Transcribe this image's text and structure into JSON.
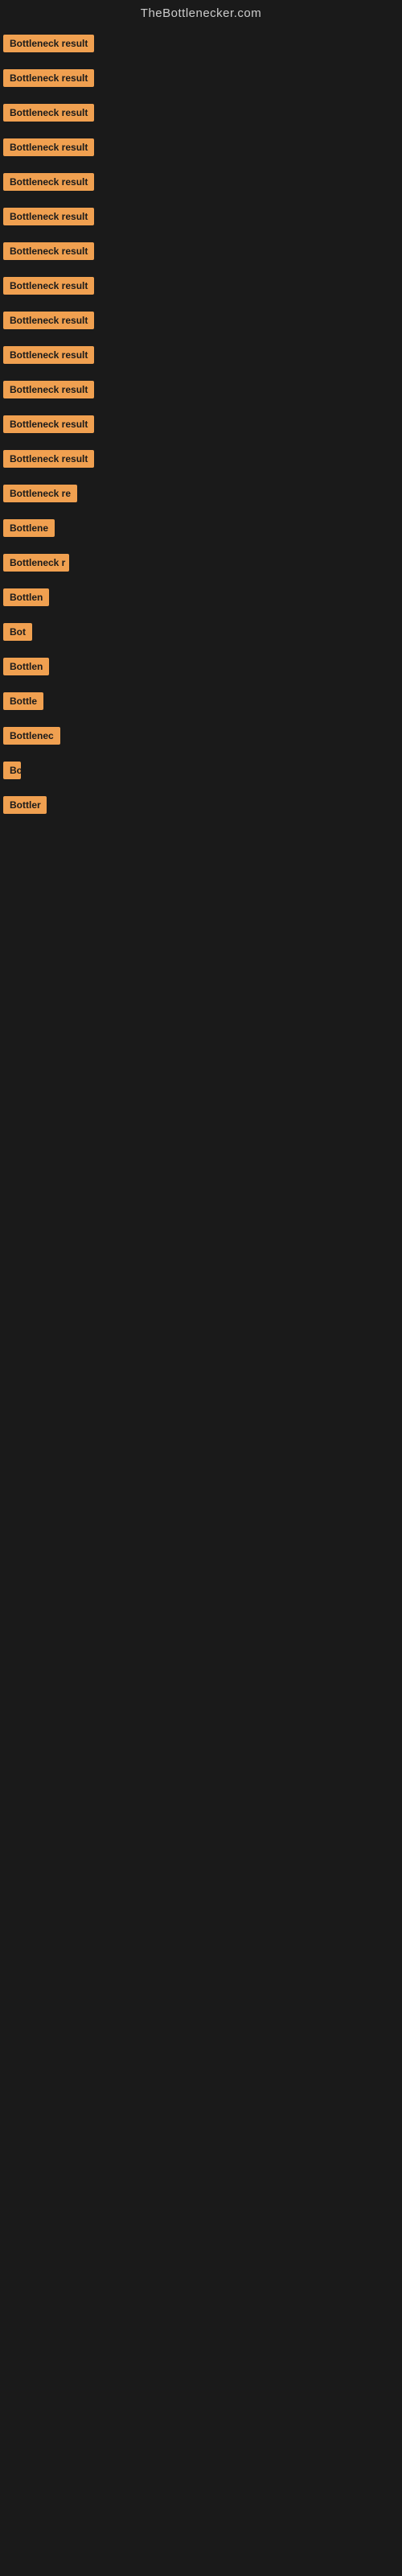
{
  "site": {
    "title": "TheBottlenecker.com"
  },
  "items": [
    {
      "id": 1,
      "label": "Bottleneck result",
      "width": 120
    },
    {
      "id": 2,
      "label": "Bottleneck result",
      "width": 120
    },
    {
      "id": 3,
      "label": "Bottleneck result",
      "width": 120
    },
    {
      "id": 4,
      "label": "Bottleneck result",
      "width": 120
    },
    {
      "id": 5,
      "label": "Bottleneck result",
      "width": 120
    },
    {
      "id": 6,
      "label": "Bottleneck result",
      "width": 120
    },
    {
      "id": 7,
      "label": "Bottleneck result",
      "width": 120
    },
    {
      "id": 8,
      "label": "Bottleneck result",
      "width": 120
    },
    {
      "id": 9,
      "label": "Bottleneck result",
      "width": 120
    },
    {
      "id": 10,
      "label": "Bottleneck result",
      "width": 120
    },
    {
      "id": 11,
      "label": "Bottleneck result",
      "width": 120
    },
    {
      "id": 12,
      "label": "Bottleneck result",
      "width": 120
    },
    {
      "id": 13,
      "label": "Bottleneck result",
      "width": 120
    },
    {
      "id": 14,
      "label": "Bottleneck re",
      "width": 108
    },
    {
      "id": 15,
      "label": "Bottlene",
      "width": 70
    },
    {
      "id": 16,
      "label": "Bottleneck r",
      "width": 82
    },
    {
      "id": 17,
      "label": "Bottlen",
      "width": 64
    },
    {
      "id": 18,
      "label": "Bot",
      "width": 40
    },
    {
      "id": 19,
      "label": "Bottlen",
      "width": 64
    },
    {
      "id": 20,
      "label": "Bottle",
      "width": 52
    },
    {
      "id": 21,
      "label": "Bottlenec",
      "width": 74
    },
    {
      "id": 22,
      "label": "Bo",
      "width": 22
    },
    {
      "id": 23,
      "label": "Bottler",
      "width": 54
    }
  ]
}
